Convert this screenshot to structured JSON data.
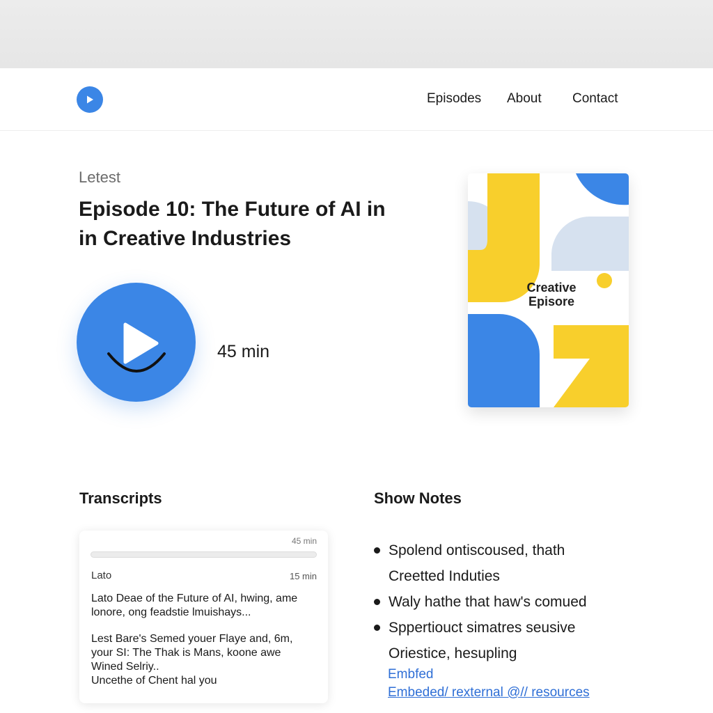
{
  "nav": {
    "logo_icon": "play-icon",
    "links": [
      "Episodes",
      "About",
      "Contact"
    ]
  },
  "hero": {
    "eyebrow": "Letest",
    "title_lines": [
      "Episode 10: The Future of AI in",
      "in Creative Industries"
    ],
    "play_icon": "play-icon",
    "duration": "45 min"
  },
  "cover": {
    "text_lines": [
      "Creative",
      "Episore"
    ],
    "colors": {
      "yellow": "#f8cf2c",
      "blue": "#3b86e6",
      "light_blue": "#d6e1ef"
    }
  },
  "transcripts": {
    "heading": "Transcripts",
    "card": {
      "duration": "45 min",
      "progress": 0,
      "label": "Lato",
      "time": "15 min",
      "para1": [
        "Lato Deae of the Future of AI, hwing, ame",
        "lonore, ong feadstie lmuishays..."
      ],
      "para2": [
        "Lest Bare's Semed youer Flaye and, 6m,",
        "your SI: The Thak is Mans, koone awe",
        "Wined Selriy..",
        "Uncethe of Chent hal you"
      ]
    }
  },
  "show_notes": {
    "heading": "Show Notes",
    "items": [
      [
        "Spolend ontiscoused, thath",
        "Creetted Induties"
      ],
      [
        "Waly hathe that haw's comued"
      ],
      [
        "Sppertiouct simatres seusive",
        "Oriestice, hesupling"
      ]
    ],
    "links": [
      "Embfed",
      "Embeded/ rexternal @// resources"
    ]
  },
  "colors": {
    "accent": "#3b86e6",
    "link": "#2f6fd6"
  }
}
